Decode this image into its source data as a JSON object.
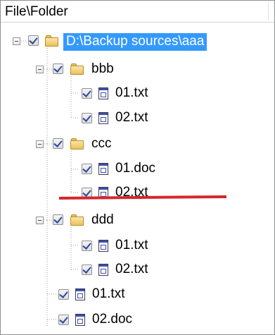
{
  "header": {
    "column_label": "File\\Folder"
  },
  "tree": {
    "root": {
      "label": "D:\\Backup sources\\aaa",
      "checked": true,
      "selected": true,
      "icon": "folder-icon"
    },
    "folder_bbb": {
      "label": "bbb",
      "checked": true,
      "icon": "folder-icon",
      "files": [
        {
          "label": "01.txt",
          "checked": true,
          "icon": "file-icon"
        },
        {
          "label": "02.txt",
          "checked": true,
          "icon": "file-icon"
        }
      ]
    },
    "folder_ccc": {
      "label": "ccc",
      "checked": true,
      "icon": "folder-icon",
      "files": [
        {
          "label": "01.doc",
          "checked": true,
          "icon": "file-icon"
        },
        {
          "label": "02.txt",
          "checked": true,
          "icon": "file-icon",
          "struck_out": true
        }
      ]
    },
    "folder_ddd": {
      "label": "ddd",
      "checked": true,
      "icon": "folder-icon",
      "files": [
        {
          "label": "01.txt",
          "checked": true,
          "icon": "file-icon"
        },
        {
          "label": "02.txt",
          "checked": true,
          "icon": "file-icon"
        }
      ]
    },
    "root_files": [
      {
        "label": "01.txt",
        "checked": true,
        "icon": "file-icon"
      },
      {
        "label": "02.doc",
        "checked": true,
        "icon": "file-icon"
      }
    ]
  },
  "colors": {
    "selection": "#3399ff",
    "strike_line": "#d6262d",
    "checkmark": "#2b4aa0",
    "folder": "#e9c25b"
  }
}
